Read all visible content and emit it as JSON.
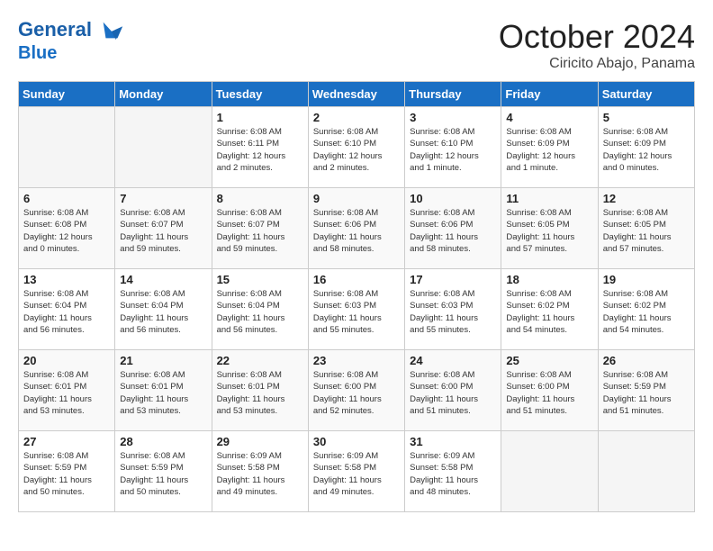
{
  "header": {
    "logo_line1": "General",
    "logo_line2": "Blue",
    "month": "October 2024",
    "location": "Ciricito Abajo, Panama"
  },
  "days_of_week": [
    "Sunday",
    "Monday",
    "Tuesday",
    "Wednesday",
    "Thursday",
    "Friday",
    "Saturday"
  ],
  "weeks": [
    [
      {
        "day": "",
        "empty": true
      },
      {
        "day": "",
        "empty": true
      },
      {
        "day": "1",
        "detail": "Sunrise: 6:08 AM\nSunset: 6:11 PM\nDaylight: 12 hours\nand 2 minutes."
      },
      {
        "day": "2",
        "detail": "Sunrise: 6:08 AM\nSunset: 6:10 PM\nDaylight: 12 hours\nand 2 minutes."
      },
      {
        "day": "3",
        "detail": "Sunrise: 6:08 AM\nSunset: 6:10 PM\nDaylight: 12 hours\nand 1 minute."
      },
      {
        "day": "4",
        "detail": "Sunrise: 6:08 AM\nSunset: 6:09 PM\nDaylight: 12 hours\nand 1 minute."
      },
      {
        "day": "5",
        "detail": "Sunrise: 6:08 AM\nSunset: 6:09 PM\nDaylight: 12 hours\nand 0 minutes."
      }
    ],
    [
      {
        "day": "6",
        "detail": "Sunrise: 6:08 AM\nSunset: 6:08 PM\nDaylight: 12 hours\nand 0 minutes."
      },
      {
        "day": "7",
        "detail": "Sunrise: 6:08 AM\nSunset: 6:07 PM\nDaylight: 11 hours\nand 59 minutes."
      },
      {
        "day": "8",
        "detail": "Sunrise: 6:08 AM\nSunset: 6:07 PM\nDaylight: 11 hours\nand 59 minutes."
      },
      {
        "day": "9",
        "detail": "Sunrise: 6:08 AM\nSunset: 6:06 PM\nDaylight: 11 hours\nand 58 minutes."
      },
      {
        "day": "10",
        "detail": "Sunrise: 6:08 AM\nSunset: 6:06 PM\nDaylight: 11 hours\nand 58 minutes."
      },
      {
        "day": "11",
        "detail": "Sunrise: 6:08 AM\nSunset: 6:05 PM\nDaylight: 11 hours\nand 57 minutes."
      },
      {
        "day": "12",
        "detail": "Sunrise: 6:08 AM\nSunset: 6:05 PM\nDaylight: 11 hours\nand 57 minutes."
      }
    ],
    [
      {
        "day": "13",
        "detail": "Sunrise: 6:08 AM\nSunset: 6:04 PM\nDaylight: 11 hours\nand 56 minutes."
      },
      {
        "day": "14",
        "detail": "Sunrise: 6:08 AM\nSunset: 6:04 PM\nDaylight: 11 hours\nand 56 minutes."
      },
      {
        "day": "15",
        "detail": "Sunrise: 6:08 AM\nSunset: 6:04 PM\nDaylight: 11 hours\nand 56 minutes."
      },
      {
        "day": "16",
        "detail": "Sunrise: 6:08 AM\nSunset: 6:03 PM\nDaylight: 11 hours\nand 55 minutes."
      },
      {
        "day": "17",
        "detail": "Sunrise: 6:08 AM\nSunset: 6:03 PM\nDaylight: 11 hours\nand 55 minutes."
      },
      {
        "day": "18",
        "detail": "Sunrise: 6:08 AM\nSunset: 6:02 PM\nDaylight: 11 hours\nand 54 minutes."
      },
      {
        "day": "19",
        "detail": "Sunrise: 6:08 AM\nSunset: 6:02 PM\nDaylight: 11 hours\nand 54 minutes."
      }
    ],
    [
      {
        "day": "20",
        "detail": "Sunrise: 6:08 AM\nSunset: 6:01 PM\nDaylight: 11 hours\nand 53 minutes."
      },
      {
        "day": "21",
        "detail": "Sunrise: 6:08 AM\nSunset: 6:01 PM\nDaylight: 11 hours\nand 53 minutes."
      },
      {
        "day": "22",
        "detail": "Sunrise: 6:08 AM\nSunset: 6:01 PM\nDaylight: 11 hours\nand 53 minutes."
      },
      {
        "day": "23",
        "detail": "Sunrise: 6:08 AM\nSunset: 6:00 PM\nDaylight: 11 hours\nand 52 minutes."
      },
      {
        "day": "24",
        "detail": "Sunrise: 6:08 AM\nSunset: 6:00 PM\nDaylight: 11 hours\nand 51 minutes."
      },
      {
        "day": "25",
        "detail": "Sunrise: 6:08 AM\nSunset: 6:00 PM\nDaylight: 11 hours\nand 51 minutes."
      },
      {
        "day": "26",
        "detail": "Sunrise: 6:08 AM\nSunset: 5:59 PM\nDaylight: 11 hours\nand 51 minutes."
      }
    ],
    [
      {
        "day": "27",
        "detail": "Sunrise: 6:08 AM\nSunset: 5:59 PM\nDaylight: 11 hours\nand 50 minutes."
      },
      {
        "day": "28",
        "detail": "Sunrise: 6:08 AM\nSunset: 5:59 PM\nDaylight: 11 hours\nand 50 minutes."
      },
      {
        "day": "29",
        "detail": "Sunrise: 6:09 AM\nSunset: 5:58 PM\nDaylight: 11 hours\nand 49 minutes."
      },
      {
        "day": "30",
        "detail": "Sunrise: 6:09 AM\nSunset: 5:58 PM\nDaylight: 11 hours\nand 49 minutes."
      },
      {
        "day": "31",
        "detail": "Sunrise: 6:09 AM\nSunset: 5:58 PM\nDaylight: 11 hours\nand 48 minutes."
      },
      {
        "day": "",
        "empty": true
      },
      {
        "day": "",
        "empty": true
      }
    ]
  ]
}
